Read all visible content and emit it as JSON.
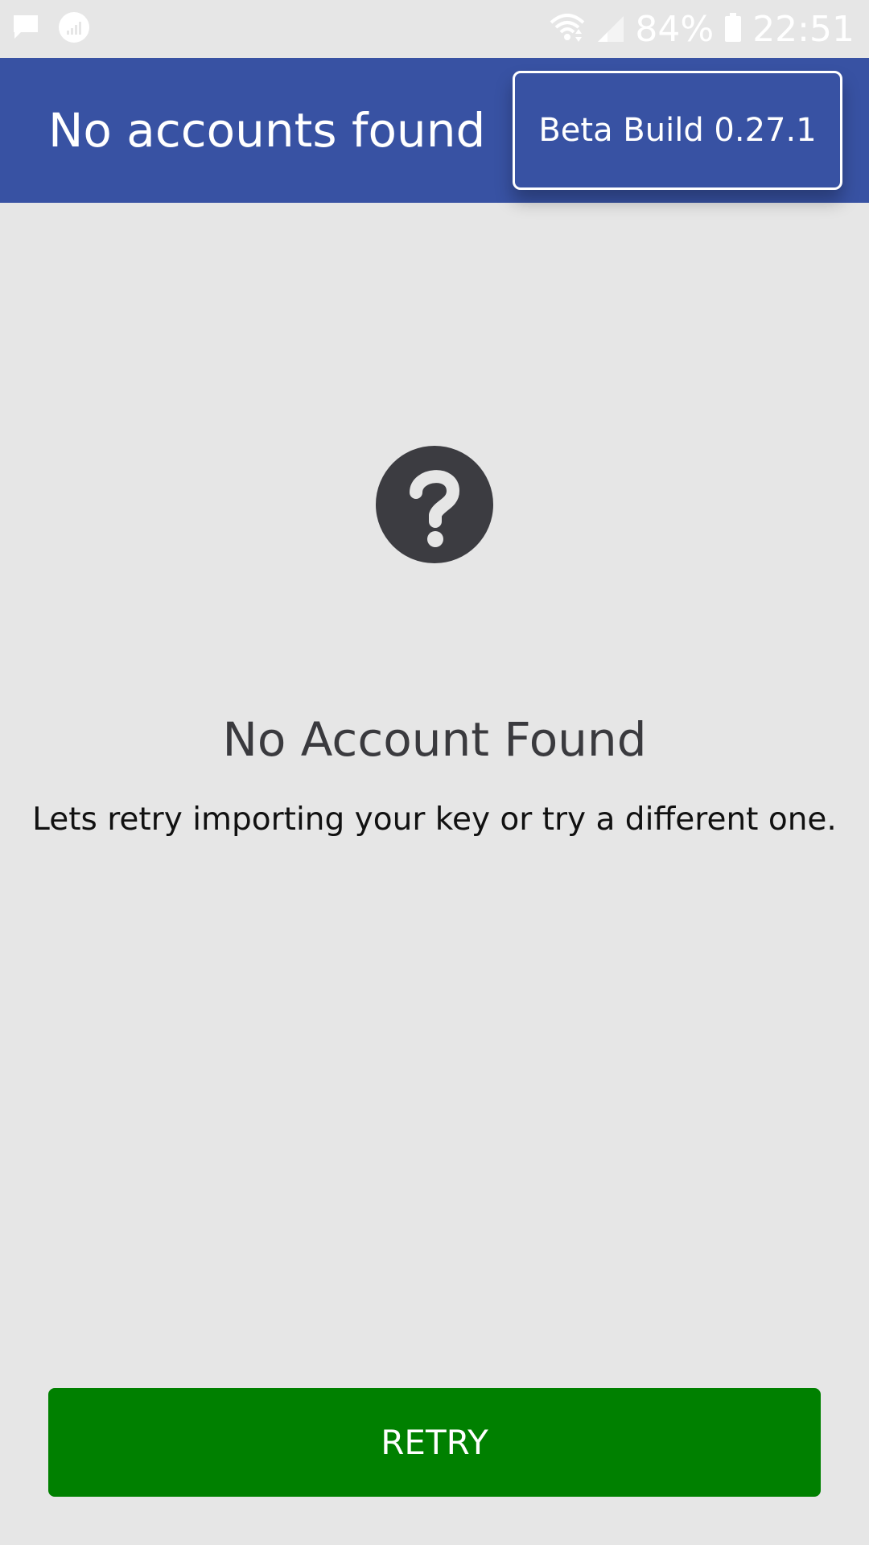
{
  "status_bar": {
    "notification_icons": [
      "message-icon",
      "data-usage-icon"
    ],
    "status_icons": [
      "wifi-icon",
      "signal-icon",
      "battery-icon"
    ],
    "battery": "84%",
    "time": "22:51"
  },
  "app_bar": {
    "title": "No accounts found",
    "build_label": "Beta Build 0.27.1",
    "color": "#3852a3"
  },
  "empty_state": {
    "icon": "help-circle-icon",
    "title": "No Account Found",
    "message": "Lets retry importing your key or try a different one."
  },
  "actions": {
    "retry_label": "RETRY",
    "retry_color": "#008000"
  }
}
